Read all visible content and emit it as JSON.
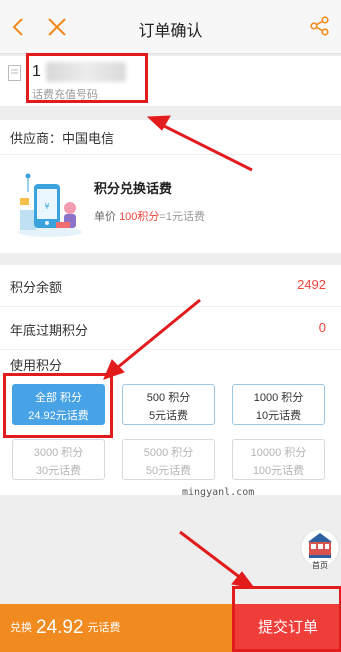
{
  "nav": {
    "title": "订单确认",
    "back_icon": "chevron-left-icon",
    "close_icon": "close-icon",
    "share_icon": "share-icon",
    "accent_color": "#f08a1e"
  },
  "recharge": {
    "phone_number": "1",
    "hint": "话费充值号码"
  },
  "supplier": {
    "label": "供应商：中国电信"
  },
  "product": {
    "name": "积分兑换话费",
    "price_prefix": "单价",
    "price_points": "100积分",
    "price_suffix": "=1元话费"
  },
  "points": {
    "balance_label": "积分余额",
    "balance_value": "2492",
    "expiring_label": "年底过期积分",
    "expiring_value": "0",
    "use_label": "使用积分"
  },
  "options": [
    {
      "points": "全部 积分",
      "value": "24.92元话费",
      "state": "selected"
    },
    {
      "points": "500 积分",
      "value": "5元话费",
      "state": "enabled"
    },
    {
      "points": "1000 积分",
      "value": "10元话费",
      "state": "enabled"
    },
    {
      "points": "3000 积分",
      "value": "30元话费",
      "state": "disabled"
    },
    {
      "points": "5000 积分",
      "value": "50元话费",
      "state": "disabled"
    },
    {
      "points": "10000 积分",
      "value": "100元话费",
      "state": "disabled"
    }
  ],
  "float_home": {
    "label": "首页"
  },
  "footer": {
    "prefix": "兑换",
    "amount": "24.92",
    "suffix": "元话费",
    "submit_label": "提交订单",
    "bar_color": "#f18a1f",
    "submit_color": "#ef3e3a"
  },
  "watermark": "mingyanl.com",
  "annotation_color": "#e21c1c"
}
